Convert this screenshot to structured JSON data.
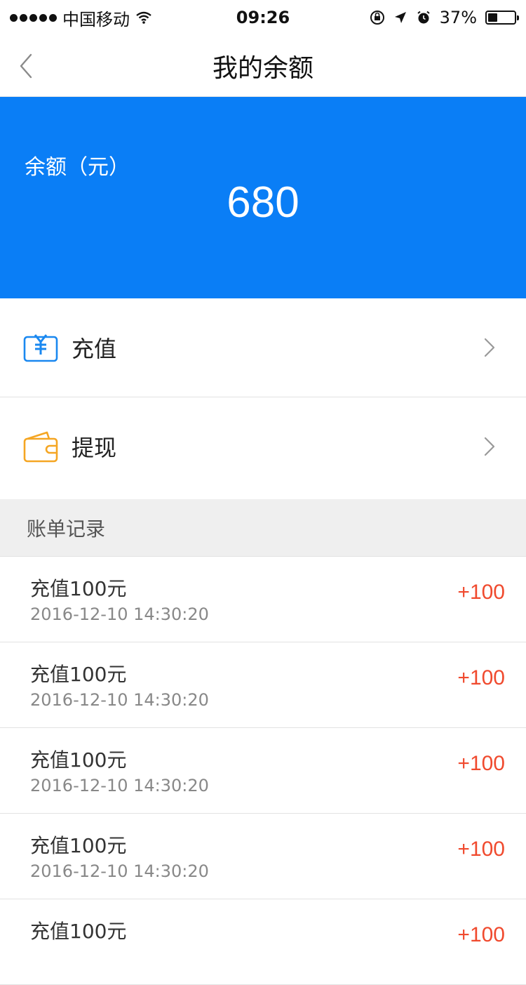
{
  "status_bar": {
    "carrier": "中国移动",
    "time": "09:26",
    "battery_text": "37%",
    "battery_level": 0.37
  },
  "nav": {
    "title": "我的余额"
  },
  "balance": {
    "label": "余额（元）",
    "value": "680"
  },
  "menu": {
    "recharge_label": "充值",
    "withdraw_label": "提现"
  },
  "colors": {
    "primary_blue": "#0a7ef6",
    "amount_red": "#f04a2e",
    "withdraw_orange": "#f5a623"
  },
  "records_header": "账单记录",
  "records": [
    {
      "title": "充值100元",
      "time": "2016-12-10 14:30:20",
      "amount": "+100"
    },
    {
      "title": "充值100元",
      "time": "2016-12-10 14:30:20",
      "amount": "+100"
    },
    {
      "title": "充值100元",
      "time": "2016-12-10 14:30:20",
      "amount": "+100"
    },
    {
      "title": "充值100元",
      "time": "2016-12-10 14:30:20",
      "amount": "+100"
    },
    {
      "title": "充值100元",
      "time": "",
      "amount": "+100"
    }
  ]
}
